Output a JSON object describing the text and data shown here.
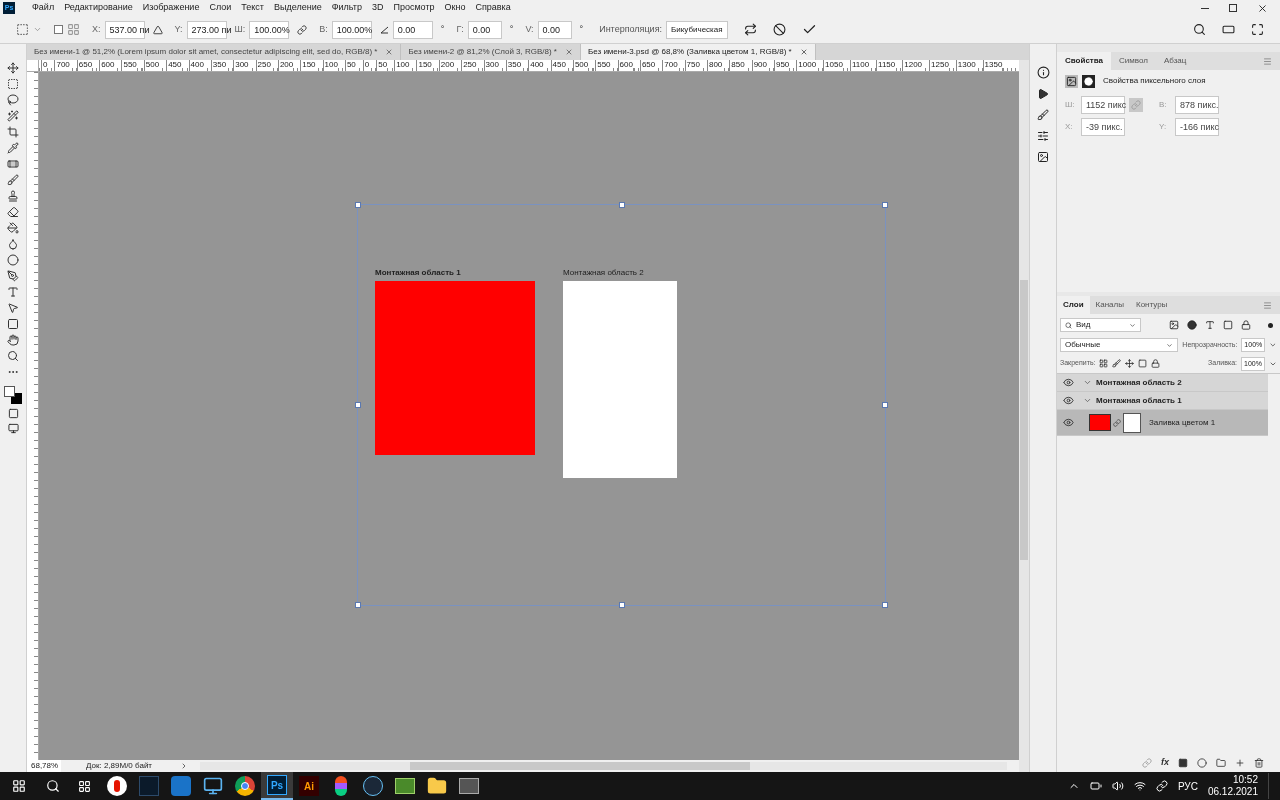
{
  "app": {
    "logo": "Ps"
  },
  "menu": [
    "Файл",
    "Редактирование",
    "Изображение",
    "Слои",
    "Текст",
    "Выделение",
    "Фильтр",
    "3D",
    "Просмотр",
    "Окно",
    "Справка"
  ],
  "options_bar": {
    "reference_checked": false,
    "fields": [
      {
        "kind": "position",
        "label": "X:",
        "value": "537.00 пи"
      },
      {
        "kind": "position2",
        "label": "Y:",
        "value": "273.00 пи"
      },
      {
        "kind": "width",
        "label": "Ш:",
        "value": "100.00%"
      },
      {
        "kind": "height",
        "label": "В:",
        "value": "100.00%"
      },
      {
        "kind": "angle",
        "value": "0.00",
        "unit": "°"
      },
      {
        "kind": "skew",
        "label": "Г:",
        "value": "0.00",
        "unit": "°"
      },
      {
        "kind": "skew",
        "label": "V:",
        "value": "0.00",
        "unit": "°"
      }
    ],
    "interpolation": {
      "label": "Интерполяция:",
      "value": "Бикубическая"
    }
  },
  "documents": [
    {
      "title": "Без имени-1 @ 51,2% (Lorem ipsum dolor sit amet, consectetur adipiscing elit, sed do, RGB/8) *",
      "selected": false
    },
    {
      "title": "Без имени-2 @ 81,2% (Слой 3, RGB/8) *",
      "selected": false
    },
    {
      "title": "Без имени-3.psd @ 68,8% (Заливка цветом 1, RGB/8) *",
      "selected": true
    }
  ],
  "ruler": {
    "labels": [
      "0",
      "700",
      "650",
      "600",
      "550",
      "500",
      "450",
      "400",
      "350",
      "300",
      "250",
      "200",
      "150",
      "100",
      "50",
      "0",
      "50",
      "100",
      "150",
      "200",
      "250",
      "300",
      "350",
      "400",
      "450",
      "500",
      "550",
      "600",
      "650",
      "700",
      "750",
      "800",
      "850",
      "900",
      "950",
      "1000",
      "1050",
      "1100",
      "1150",
      "1200",
      "1250",
      "1300",
      "1350"
    ]
  },
  "artboards": [
    {
      "label": "Монтажная область 1",
      "color": "#ff0000",
      "selected": true
    },
    {
      "label": "Монтажная область 2",
      "color": "#ffffff",
      "selected": false
    }
  ],
  "properties": {
    "tabs": [
      {
        "label": "Свойства",
        "selected": true
      },
      {
        "label": "Символ",
        "selected": false
      },
      {
        "label": "Абзац",
        "selected": false
      }
    ],
    "title": "Свойства пиксельного слоя",
    "fields": [
      {
        "label": "Ш:",
        "value": "1152 пикс"
      },
      {
        "label": "В:",
        "value": "878 пикс."
      },
      {
        "label": "X:",
        "value": "-39 пикс."
      },
      {
        "label": "Y:",
        "value": "-166 пикс"
      }
    ]
  },
  "layers": {
    "tabs": [
      {
        "label": "Слои",
        "selected": true
      },
      {
        "label": "Каналы",
        "selected": false
      },
      {
        "label": "Контуры",
        "selected": false
      }
    ],
    "fx_label": "fx",
    "filter": "Вид",
    "blend_mode": "Обычные",
    "opacity_label": "Непрозрачность:",
    "opacity": "100%",
    "lock_label": "Закрепить:",
    "fill_label": "Заливка:",
    "fill": "100%",
    "items": [
      {
        "name": "Монтажная область 2",
        "kind": "artboard",
        "visible": true,
        "expanded": true,
        "selected": false
      },
      {
        "name": "Монтажная область 1",
        "kind": "artboard",
        "visible": true,
        "expanded": true,
        "selected": false,
        "children": [
          {
            "name": "Заливка цветом 1",
            "kind": "fill",
            "color": "#ff0000",
            "visible": true,
            "selected": true
          }
        ]
      }
    ]
  },
  "status": {
    "zoom": "68,78%",
    "doc": "Док: 2,89M/0 байт"
  },
  "taskbar": {
    "apps": [
      {
        "kind": "yandex",
        "selected": false
      },
      {
        "kind": "dark",
        "selected": false
      },
      {
        "kind": "blue",
        "selected": false
      },
      {
        "kind": "computer",
        "selected": false
      },
      {
        "kind": "chrome",
        "selected": false
      },
      {
        "kind": "photoshop",
        "text": "Ps",
        "selected": true
      },
      {
        "kind": "illustrator",
        "text": "Ai",
        "selected": false
      },
      {
        "kind": "figma",
        "selected": false
      },
      {
        "kind": "steam",
        "selected": false
      },
      {
        "kind": "green",
        "selected": false
      },
      {
        "kind": "folder",
        "selected": false
      },
      {
        "kind": "tablet",
        "selected": false
      }
    ],
    "language": "РУС",
    "time": "10:52",
    "date": "06.12.2021"
  }
}
